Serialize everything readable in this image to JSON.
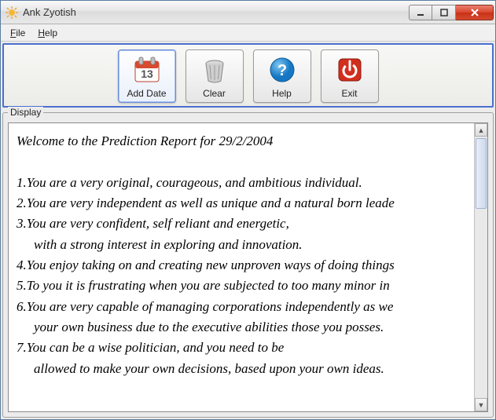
{
  "window": {
    "title": "Ank Zyotish"
  },
  "menubar": {
    "file": "File",
    "help": "Help"
  },
  "toolbar": {
    "addDate": {
      "label": "Add Date",
      "calendarDay": "13"
    },
    "clear": {
      "label": "Clear"
    },
    "help": {
      "label": "Help"
    },
    "exit": {
      "label": "Exit"
    }
  },
  "display": {
    "groupLabel": "Display",
    "heading": "Welcome to the Prediction Report for 29/2/2004",
    "lines": {
      "l1": "1.You are a very original, courageous, and ambitious individual.",
      "l2": "2.You are very independent as well as unique and a natural born leade",
      "l3": "3.You are very confident, self reliant and energetic,",
      "l3b": "with a strong interest in exploring and innovation.",
      "l4": "4.You enjoy taking on and creating new unproven ways of doing things",
      "l5": "5.To you it is frustrating when you are subjected to too many minor in",
      "l6": "6.You are very capable of managing corporations independently as we",
      "l6b": "your own business due to the executive abilities those you posses.",
      "l7": "7.You can be a wise politician, and you need to be",
      "l7b": "allowed to make your own decisions, based upon your own ideas."
    }
  }
}
